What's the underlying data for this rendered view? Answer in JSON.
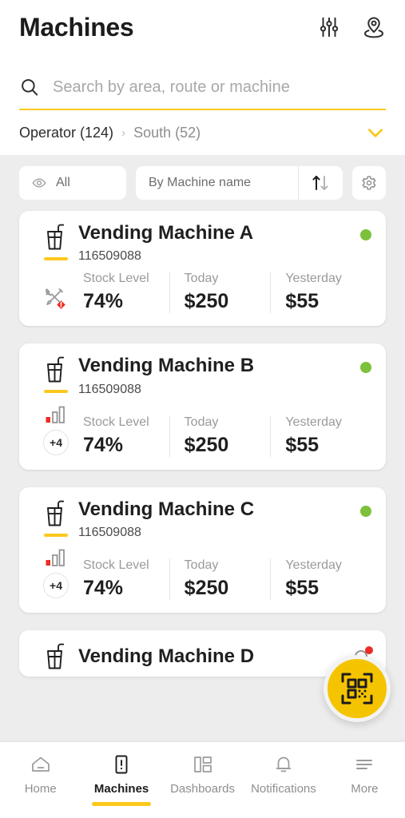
{
  "header": {
    "title": "Machines",
    "icons": [
      {
        "name": "filter-sliders-icon"
      },
      {
        "name": "location-pin-icon"
      }
    ]
  },
  "search": {
    "placeholder": "Search by area, route or machine",
    "value": "",
    "icon": "search-icon"
  },
  "breadcrumb": {
    "parent": "Operator (124)",
    "separator": "›",
    "current": "South (52)",
    "expand_icon": "chevron-down-icon"
  },
  "filters": {
    "view_label": "All",
    "view_icon": "eye-icon",
    "sort_label": "By Machine name",
    "sort_icon": "sort-arrows-icon",
    "settings_icon": "gear-icon"
  },
  "machines": [
    {
      "name": "Vending Machine A",
      "id": "116509088",
      "status": "online",
      "status_color": "#7cc13c",
      "alert_icon": "tools-alert-icon",
      "badge": null,
      "stats": [
        {
          "label": "Stock Level",
          "value": "74%"
        },
        {
          "label": "Today",
          "value": "$250"
        },
        {
          "label": "Yesterday",
          "value": "$55"
        }
      ]
    },
    {
      "name": "Vending Machine B",
      "id": "116509088",
      "status": "online",
      "status_color": "#7cc13c",
      "alert_icon": "signal-bars-icon",
      "badge": "+4",
      "stats": [
        {
          "label": "Stock Level",
          "value": "74%"
        },
        {
          "label": "Today",
          "value": "$250"
        },
        {
          "label": "Yesterday",
          "value": "$55"
        }
      ]
    },
    {
      "name": "Vending Machine C",
      "id": "116509088",
      "status": "online",
      "status_color": "#7cc13c",
      "alert_icon": "signal-bars-icon",
      "badge": "+4",
      "stats": [
        {
          "label": "Stock Level",
          "value": "74%"
        },
        {
          "label": "Today",
          "value": "$250"
        },
        {
          "label": "Yesterday",
          "value": "$55"
        }
      ]
    },
    {
      "name": "Vending Machine D",
      "id": "",
      "status": "online",
      "status_color": "#7cc13c",
      "alert_icon": "bell-alert-icon",
      "badge": null,
      "stats": []
    }
  ],
  "fab": {
    "icon": "qr-scan-icon",
    "color": "#f5c400"
  },
  "bottom_nav": [
    {
      "label": "Home",
      "icon": "home-icon",
      "active": false
    },
    {
      "label": "Machines",
      "icon": "machine-icon",
      "active": true
    },
    {
      "label": "Dashboards",
      "icon": "dashboard-grid-icon",
      "active": false
    },
    {
      "label": "Notifications",
      "icon": "bell-icon",
      "active": false
    },
    {
      "label": "More",
      "icon": "more-lines-icon",
      "active": false
    }
  ],
  "theme": {
    "accent": "#fbc81d",
    "background": "#ededed",
    "card": "#ffffff",
    "alert": "#ee2b24"
  }
}
